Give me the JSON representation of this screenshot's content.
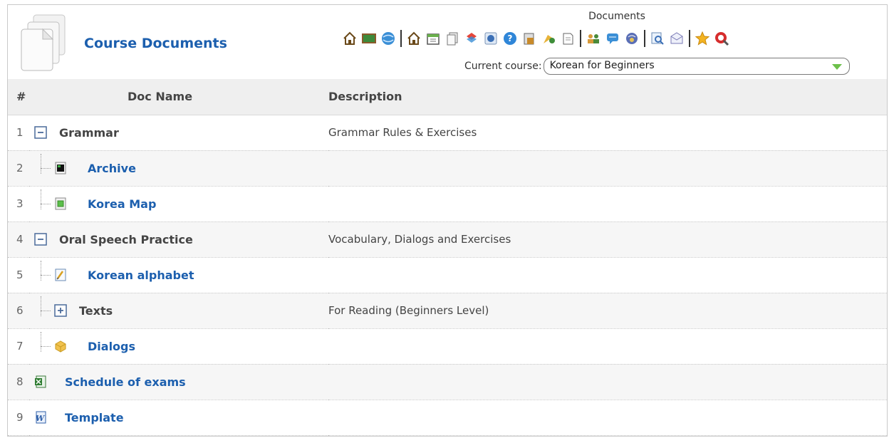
{
  "header": {
    "title": "Course Documents",
    "toolbar_caption": "Documents",
    "course_label": "Current course:",
    "course_selected": "Korean for Beginners"
  },
  "toolbar": {
    "groups": [
      [
        "home-icon",
        "blackboard-icon",
        "globe-icon"
      ],
      [
        "home-icon",
        "calendar-icon",
        "documents-icon",
        "puzzle-icon",
        "disc-icon",
        "help-icon",
        "gradebook-icon",
        "paint-icon",
        "notes-icon"
      ],
      [
        "users-icon",
        "chat-icon",
        "forum-icon"
      ],
      [
        "search-icon",
        "mail-icon"
      ],
      [
        "star-icon",
        "logout-icon"
      ]
    ]
  },
  "table": {
    "columns": [
      "#",
      "Doc Name",
      "Description"
    ],
    "rows": [
      {
        "num": "1",
        "name": "Grammar",
        "description": "Grammar Rules & Exercises",
        "kind": "folder",
        "icon": "collapse-icon",
        "level": 0
      },
      {
        "num": "2",
        "name": "Archive",
        "description": "",
        "kind": "file",
        "icon": "terminal-file-icon",
        "level": 1
      },
      {
        "num": "3",
        "name": "Korea Map",
        "description": "",
        "kind": "file",
        "icon": "image-file-icon",
        "level": 1
      },
      {
        "num": "4",
        "name": "Oral Speech Practice",
        "description": "Vocabulary, Dialogs and Exercises",
        "kind": "folder",
        "icon": "collapse-icon",
        "level": 0
      },
      {
        "num": "5",
        "name": "Korean alphabet",
        "description": "",
        "kind": "file",
        "icon": "text-file-icon",
        "level": 1
      },
      {
        "num": "6",
        "name": "Texts",
        "description": "For Reading (Beginners Level)",
        "kind": "folder",
        "icon": "expand-icon",
        "level": 1
      },
      {
        "num": "7",
        "name": "Dialogs",
        "description": "",
        "kind": "file",
        "icon": "package-icon",
        "level": 1
      },
      {
        "num": "8",
        "name": "Schedule of exams",
        "description": "",
        "kind": "file",
        "icon": "excel-file-icon",
        "level": 0
      },
      {
        "num": "9",
        "name": "Template",
        "description": "",
        "kind": "file",
        "icon": "word-file-icon",
        "level": 0
      }
    ]
  }
}
